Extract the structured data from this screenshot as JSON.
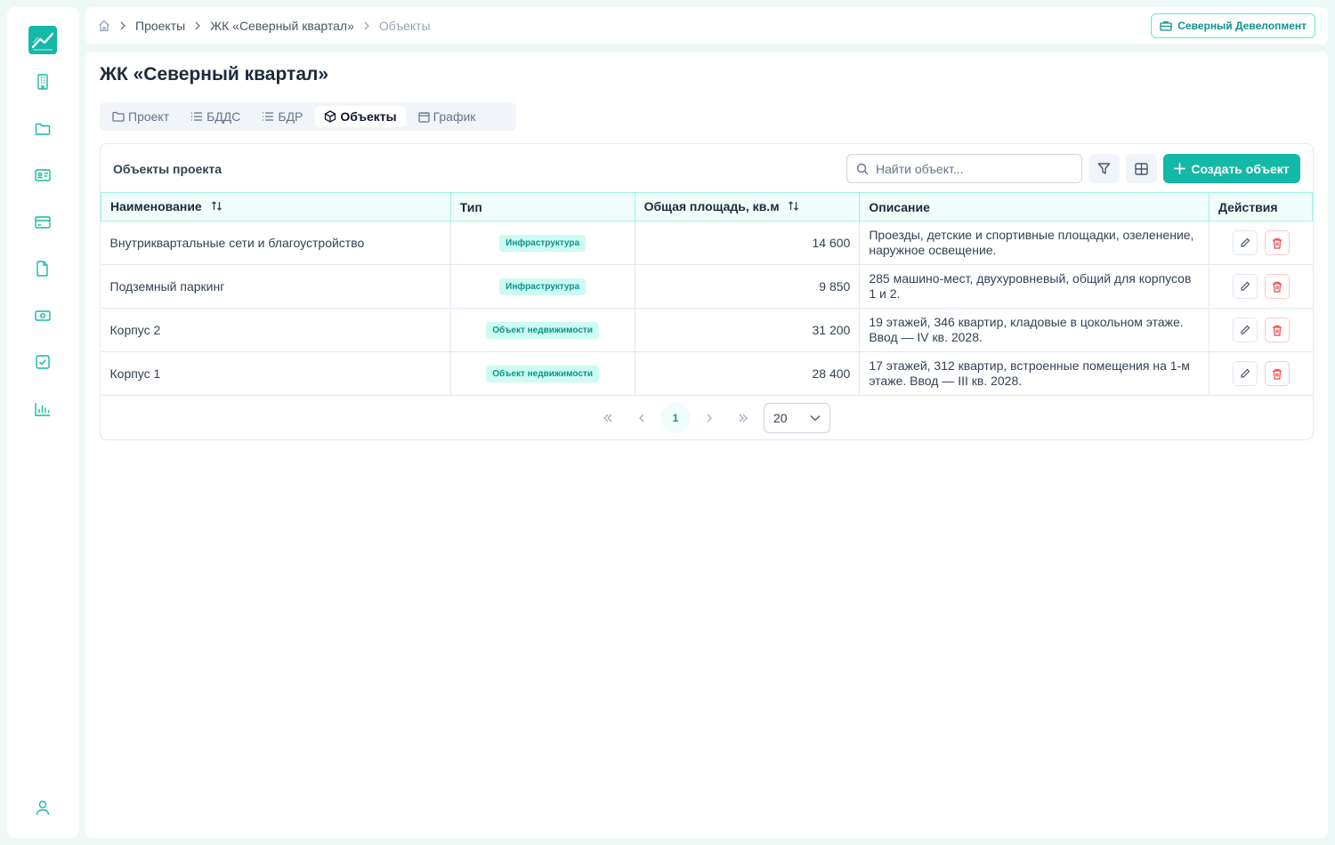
{
  "breadcrumb": {
    "projects": "Проекты",
    "project": "ЖК «Северный квартал»",
    "current": "Объекты"
  },
  "company": "Северный Девелопмент",
  "page": {
    "title": "ЖК «Северный квартал»"
  },
  "tabs": [
    {
      "label": "Проект",
      "icon": "folder-icon"
    },
    {
      "label": "БДДС",
      "icon": "list-icon"
    },
    {
      "label": "БДР",
      "icon": "list-icon"
    },
    {
      "label": "Объекты",
      "icon": "box-icon",
      "active": true
    },
    {
      "label": "График",
      "icon": "calendar-icon"
    }
  ],
  "card": {
    "title": "Объекты проекта",
    "search_placeholder": "Найти объект...",
    "create_label": "Создать объект"
  },
  "table": {
    "columns": {
      "name": "Наименование",
      "type": "Тип",
      "area": "Общая площадь, кв.м",
      "description": "Описание",
      "actions": "Действия"
    },
    "rows": [
      {
        "name": "Внутриквартальные сети и благоустройство",
        "type": "Инфраструктура",
        "area": "14 600",
        "description": "Проезды, детские и спортивные площадки, озеленение, наружное освещение."
      },
      {
        "name": "Подземный паркинг",
        "type": "Инфраструктура",
        "area": "9 850",
        "description": "285 машино-мест, двухуровневый, общий для корпусов 1 и 2."
      },
      {
        "name": "Корпус 2",
        "type": "Объект недвижимости",
        "area": "31 200",
        "description": "19 этажей, 346 квартир, кладовые в цокольном этаже. Ввод — IV кв. 2028."
      },
      {
        "name": "Корпус 1",
        "type": "Объект недвижимости",
        "area": "28 400",
        "description": "17 этажей, 312 квартир, встроенные помещения на 1-м этаже. Ввод — III кв. 2028."
      }
    ]
  },
  "pagination": {
    "current_page": "1",
    "page_size": "20"
  },
  "colors": {
    "accent": "#14b8a6",
    "accent_dark": "#0d9488",
    "danger": "#ef4444"
  }
}
